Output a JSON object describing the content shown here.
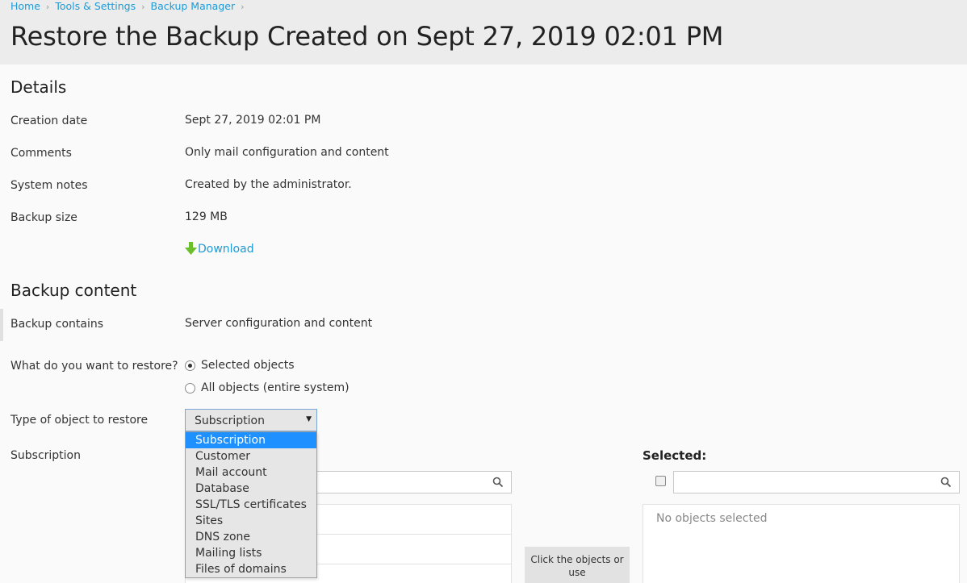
{
  "breadcrumb": [
    "Home",
    "Tools & Settings",
    "Backup Manager"
  ],
  "page_title": "Restore the Backup Created on Sept 27, 2019 02:01 PM",
  "details": {
    "title": "Details",
    "creation_date_label": "Creation date",
    "creation_date_value": "Sept 27, 2019 02:01 PM",
    "comments_label": "Comments",
    "comments_value": "Only mail configuration and content",
    "system_notes_label": "System notes",
    "system_notes_value": "Created by the administrator.",
    "backup_size_label": "Backup size",
    "backup_size_value": "129 MB",
    "download_label": "Download"
  },
  "backup_content": {
    "title": "Backup content",
    "contains_label": "Backup contains",
    "contains_value": "Server configuration and content",
    "restore_question": "What do you want to restore?",
    "options": [
      {
        "label": "Selected objects",
        "checked": true
      },
      {
        "label": "All objects (entire system)",
        "checked": false
      }
    ],
    "type_label": "Type of object to restore",
    "type_selected": "Subscription",
    "type_options": [
      "Subscription",
      "Customer",
      "Mail account",
      "Database",
      "SSL/TLS certificates",
      "Sites",
      "DNS zone",
      "Mailing lists",
      "Files of domains"
    ],
    "subscription_label": "Subscription",
    "selected_label": "Selected:",
    "no_objects": "No objects selected",
    "transfer_hint": "Click the objects or use"
  },
  "colors": {
    "link": "#1e9ad6",
    "highlight": "#1e90ff",
    "download_arrow": "#6abf2a"
  }
}
